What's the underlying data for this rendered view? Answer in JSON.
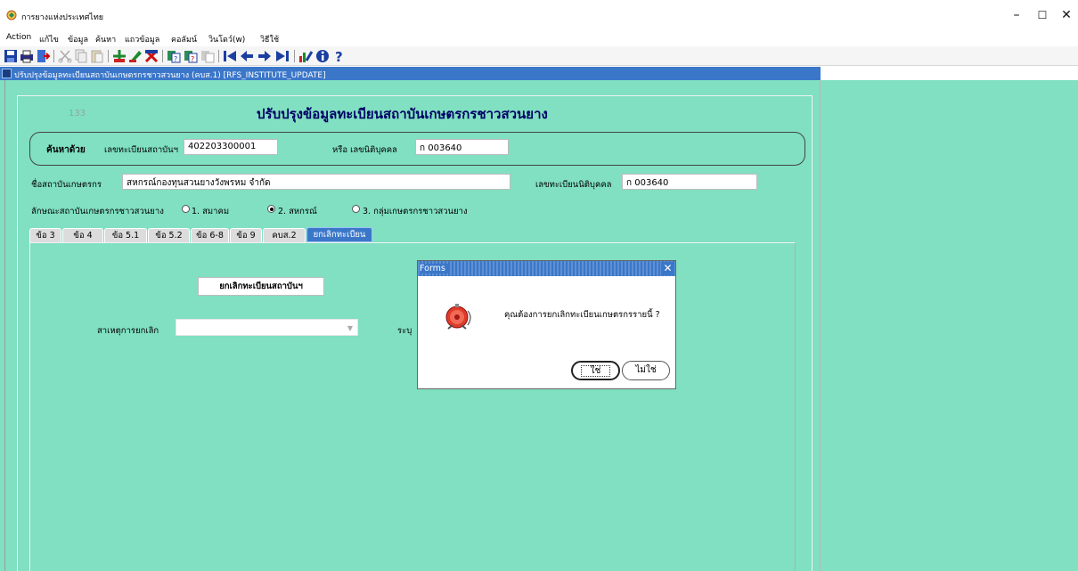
{
  "app": {
    "title": "การยางแห่งประเทศไทย",
    "window_controls": [
      "–",
      "☐",
      "✕"
    ]
  },
  "menu": [
    "Action",
    "แก้ไข",
    "ข้อมูล",
    "ค้นหา",
    "แถวข้อมูล",
    "คอลัมน์",
    "วินโดว์(w)",
    "วิธีใช้"
  ],
  "window": {
    "caption": "ปรับปรุงข้อมูลทะเบียนสถาบันเกษตรกรชาวสวนยาง (คบส.1) [RFS_INSTITUTE_UPDATE]"
  },
  "form": {
    "record_count": "133",
    "title": "ปรับปรุงข้อมูลทะเบียนสถาบันเกษตรกรชาวสวนยาง",
    "search": {
      "label": "ค้นหาด้วย",
      "reg_no_label": "เลขทะเบียนสถาบันฯ",
      "reg_no_value": "402203300001",
      "or_juristic_label": "หรือ เลขนิติบุคคล",
      "juristic_value": "ก 003640"
    },
    "institute_name_label": "ชื่อสถาบันเกษตรกร",
    "institute_name_value": "สหกรณ์กองทุนสวนยางวังพรหม จำกัด",
    "juristic_reg_label": "เลขทะเบียนนิติบุคคล",
    "juristic_reg_value": "ก 003640",
    "type_label": "ลักษณะสถาบันเกษตรกรชาวสวนยาง",
    "type_options": [
      {
        "label": "1. สมาคม",
        "checked": false
      },
      {
        "label": "2. สหกรณ์",
        "checked": true
      },
      {
        "label": "3. กลุ่มเกษตรกรชาวสวนยาง",
        "checked": false
      }
    ],
    "tabs": [
      "ข้อ 3",
      "ข้อ 4",
      "ข้อ 5.1",
      "ข้อ 5.2",
      "ข้อ 6-8",
      "ข้อ 9",
      "คบส.2",
      "ยกเลิกทะเบียน"
    ],
    "active_tab": "ยกเลิกทะเบียน",
    "cancel_section": {
      "header": "ยกเลิกทะเบียนสถาบันฯ",
      "reason_label": "สาเหตุการยกเลิก",
      "reason_value": "",
      "specify_label": "ระบุ"
    }
  },
  "dialog": {
    "title": "Forms",
    "close": "✕",
    "message": "คุณต้องการยกเลิกทะเบียนเกษตรกรรายนี้ ?",
    "yes_label": "ใช่",
    "no_label": "ไม่ใช่"
  },
  "colors": {
    "workspace": "#80e0c1",
    "caption_blue": "#3b77c9",
    "title_navy": "#000066"
  }
}
